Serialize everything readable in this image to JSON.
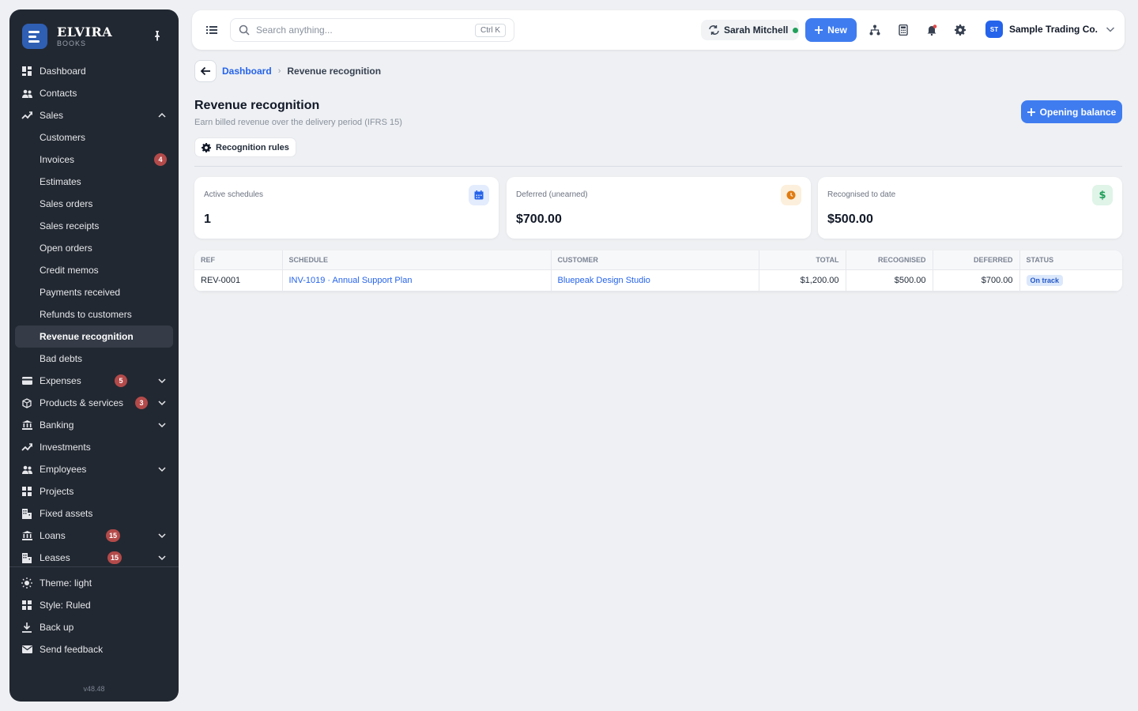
{
  "brand": {
    "name": "ELVIRA",
    "sub": "BOOKS"
  },
  "sidebar": {
    "items": [
      {
        "label": "Dashboard"
      },
      {
        "label": "Contacts"
      },
      {
        "label": "Sales"
      },
      {
        "label": "Customers"
      },
      {
        "label": "Invoices",
        "badge": "4"
      },
      {
        "label": "Estimates"
      },
      {
        "label": "Sales orders"
      },
      {
        "label": "Sales receipts"
      },
      {
        "label": "Open orders"
      },
      {
        "label": "Credit memos"
      },
      {
        "label": "Payments received"
      },
      {
        "label": "Refunds to customers"
      },
      {
        "label": "Revenue recognition"
      },
      {
        "label": "Bad debts"
      },
      {
        "label": "Expenses",
        "badge": "5"
      },
      {
        "label": "Products & services",
        "badge": "3"
      },
      {
        "label": "Banking"
      },
      {
        "label": "Investments"
      },
      {
        "label": "Employees"
      },
      {
        "label": "Projects"
      },
      {
        "label": "Fixed assets"
      },
      {
        "label": "Loans",
        "badge": "15"
      },
      {
        "label": "Leases",
        "badge": "15"
      }
    ],
    "bottom": [
      {
        "label": "Theme: light"
      },
      {
        "label": "Style: Ruled"
      },
      {
        "label": "Back up"
      },
      {
        "label": "Send feedback"
      }
    ],
    "version": "v48.48"
  },
  "topbar": {
    "search_placeholder": "Search anything...",
    "shortcut": "Ctrl K",
    "user": "Sarah Mitchell",
    "new_label": "New",
    "company_initials": "ST",
    "company": "Sample Trading Co."
  },
  "breadcrumb": {
    "parent": "Dashboard",
    "current": "Revenue recognition"
  },
  "page": {
    "title": "Revenue recognition",
    "subtitle": "Earn billed revenue over the delivery period (IFRS 15)",
    "primary_action": "Opening balance",
    "rules_button": "Recognition rules"
  },
  "cards": [
    {
      "label": "Active schedules",
      "value": "1",
      "icon": "calendar-icon",
      "color": "#2563eb",
      "bg": "#e3ecfd"
    },
    {
      "label": "Deferred (unearned)",
      "value": "$700.00",
      "icon": "clock-icon",
      "color": "#e07b12",
      "bg": "#fcefdc"
    },
    {
      "label": "Recognised to date",
      "value": "$500.00",
      "icon": "dollar-icon",
      "color": "#1f9e5a",
      "bg": "#e0f4e8"
    }
  ],
  "table": {
    "headers": {
      "ref": "REF",
      "schedule": "SCHEDULE",
      "customer": "CUSTOMER",
      "total": "TOTAL",
      "recognised": "RECOGNISED",
      "deferred": "DEFERRED",
      "status": "STATUS"
    },
    "rows": [
      {
        "ref": "REV-0001",
        "schedule": "INV-1019 · Annual Support Plan",
        "customer": "Bluepeak Design Studio",
        "total": "$1,200.00",
        "recognised": "$500.00",
        "deferred": "$700.00",
        "status": "On track"
      }
    ]
  },
  "colors": {
    "sidebar_bg": "#222831",
    "accent": "#3f7cf0",
    "link": "#2563eb",
    "badge": "#b44a4a"
  }
}
